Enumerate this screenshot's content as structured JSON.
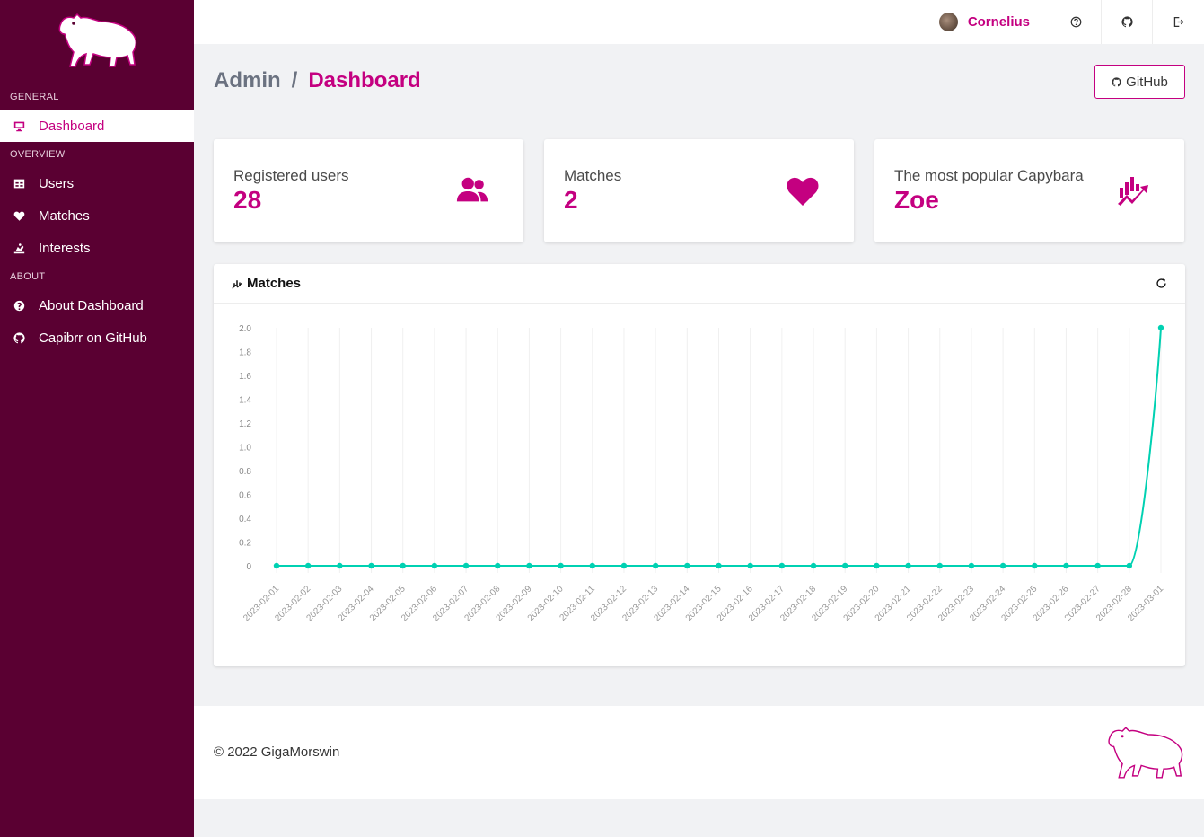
{
  "sidebar": {
    "sections": [
      {
        "label": "General",
        "items": [
          {
            "label": "Dashboard",
            "icon": "monitor-icon",
            "active": true
          }
        ]
      },
      {
        "label": "Overview",
        "items": [
          {
            "label": "Users",
            "icon": "table-icon"
          },
          {
            "label": "Matches",
            "icon": "heart-icon"
          },
          {
            "label": "Interests",
            "icon": "interests-icon"
          }
        ]
      },
      {
        "label": "About",
        "items": [
          {
            "label": "About Dashboard",
            "icon": "help-circle-icon"
          },
          {
            "label": "Capibrr on GitHub",
            "icon": "github-icon"
          }
        ]
      }
    ]
  },
  "topbar": {
    "user_name": "Cornelius",
    "buttons": [
      "help-icon",
      "github-icon",
      "logout-icon"
    ]
  },
  "titlebar": {
    "breadcrumb_root": "Admin",
    "breadcrumb_separator": "/",
    "breadcrumb_current": "Dashboard",
    "github_button": "GitHub"
  },
  "cards": [
    {
      "label": "Registered users",
      "value": "28",
      "icon": "users-icon"
    },
    {
      "label": "Matches",
      "value": "2",
      "icon": "heart-icon"
    },
    {
      "label": "The most popular Capybara",
      "value": "Zoe",
      "icon": "chart-trend-icon"
    }
  ],
  "chart_panel": {
    "title": "Matches"
  },
  "chart_data": {
    "type": "line",
    "title": "Matches",
    "xlabel": "",
    "ylabel": "",
    "ylim": [
      0,
      2
    ],
    "yticks": [
      "0",
      "0.2",
      "0.4",
      "0.6",
      "0.8",
      "1.0",
      "1.2",
      "1.4",
      "1.6",
      "1.8",
      "2.0"
    ],
    "grid": true,
    "line_color": "#00d1b2",
    "x": [
      "2023-02-01",
      "2023-02-02",
      "2023-02-03",
      "2023-02-04",
      "2023-02-05",
      "2023-02-06",
      "2023-02-07",
      "2023-02-08",
      "2023-02-09",
      "2023-02-10",
      "2023-02-11",
      "2023-02-12",
      "2023-02-13",
      "2023-02-14",
      "2023-02-15",
      "2023-02-16",
      "2023-02-17",
      "2023-02-18",
      "2023-02-19",
      "2023-02-20",
      "2023-02-21",
      "2023-02-22",
      "2023-02-23",
      "2023-02-24",
      "2023-02-25",
      "2023-02-26",
      "2023-02-27",
      "2023-02-28",
      "2023-03-01"
    ],
    "series": [
      {
        "values": [
          0,
          0,
          0,
          0,
          0,
          0,
          0,
          0,
          0,
          0,
          0,
          0,
          0,
          0,
          0,
          0,
          0,
          0,
          0,
          0,
          0,
          0,
          0,
          0,
          0,
          0,
          0,
          0,
          2
        ]
      }
    ]
  },
  "footer": {
    "text": "© 2022 GigaMorswin"
  },
  "colors": {
    "sidebar_bg": "#5a0032",
    "accent": "#c40080",
    "line": "#00d1b2"
  }
}
